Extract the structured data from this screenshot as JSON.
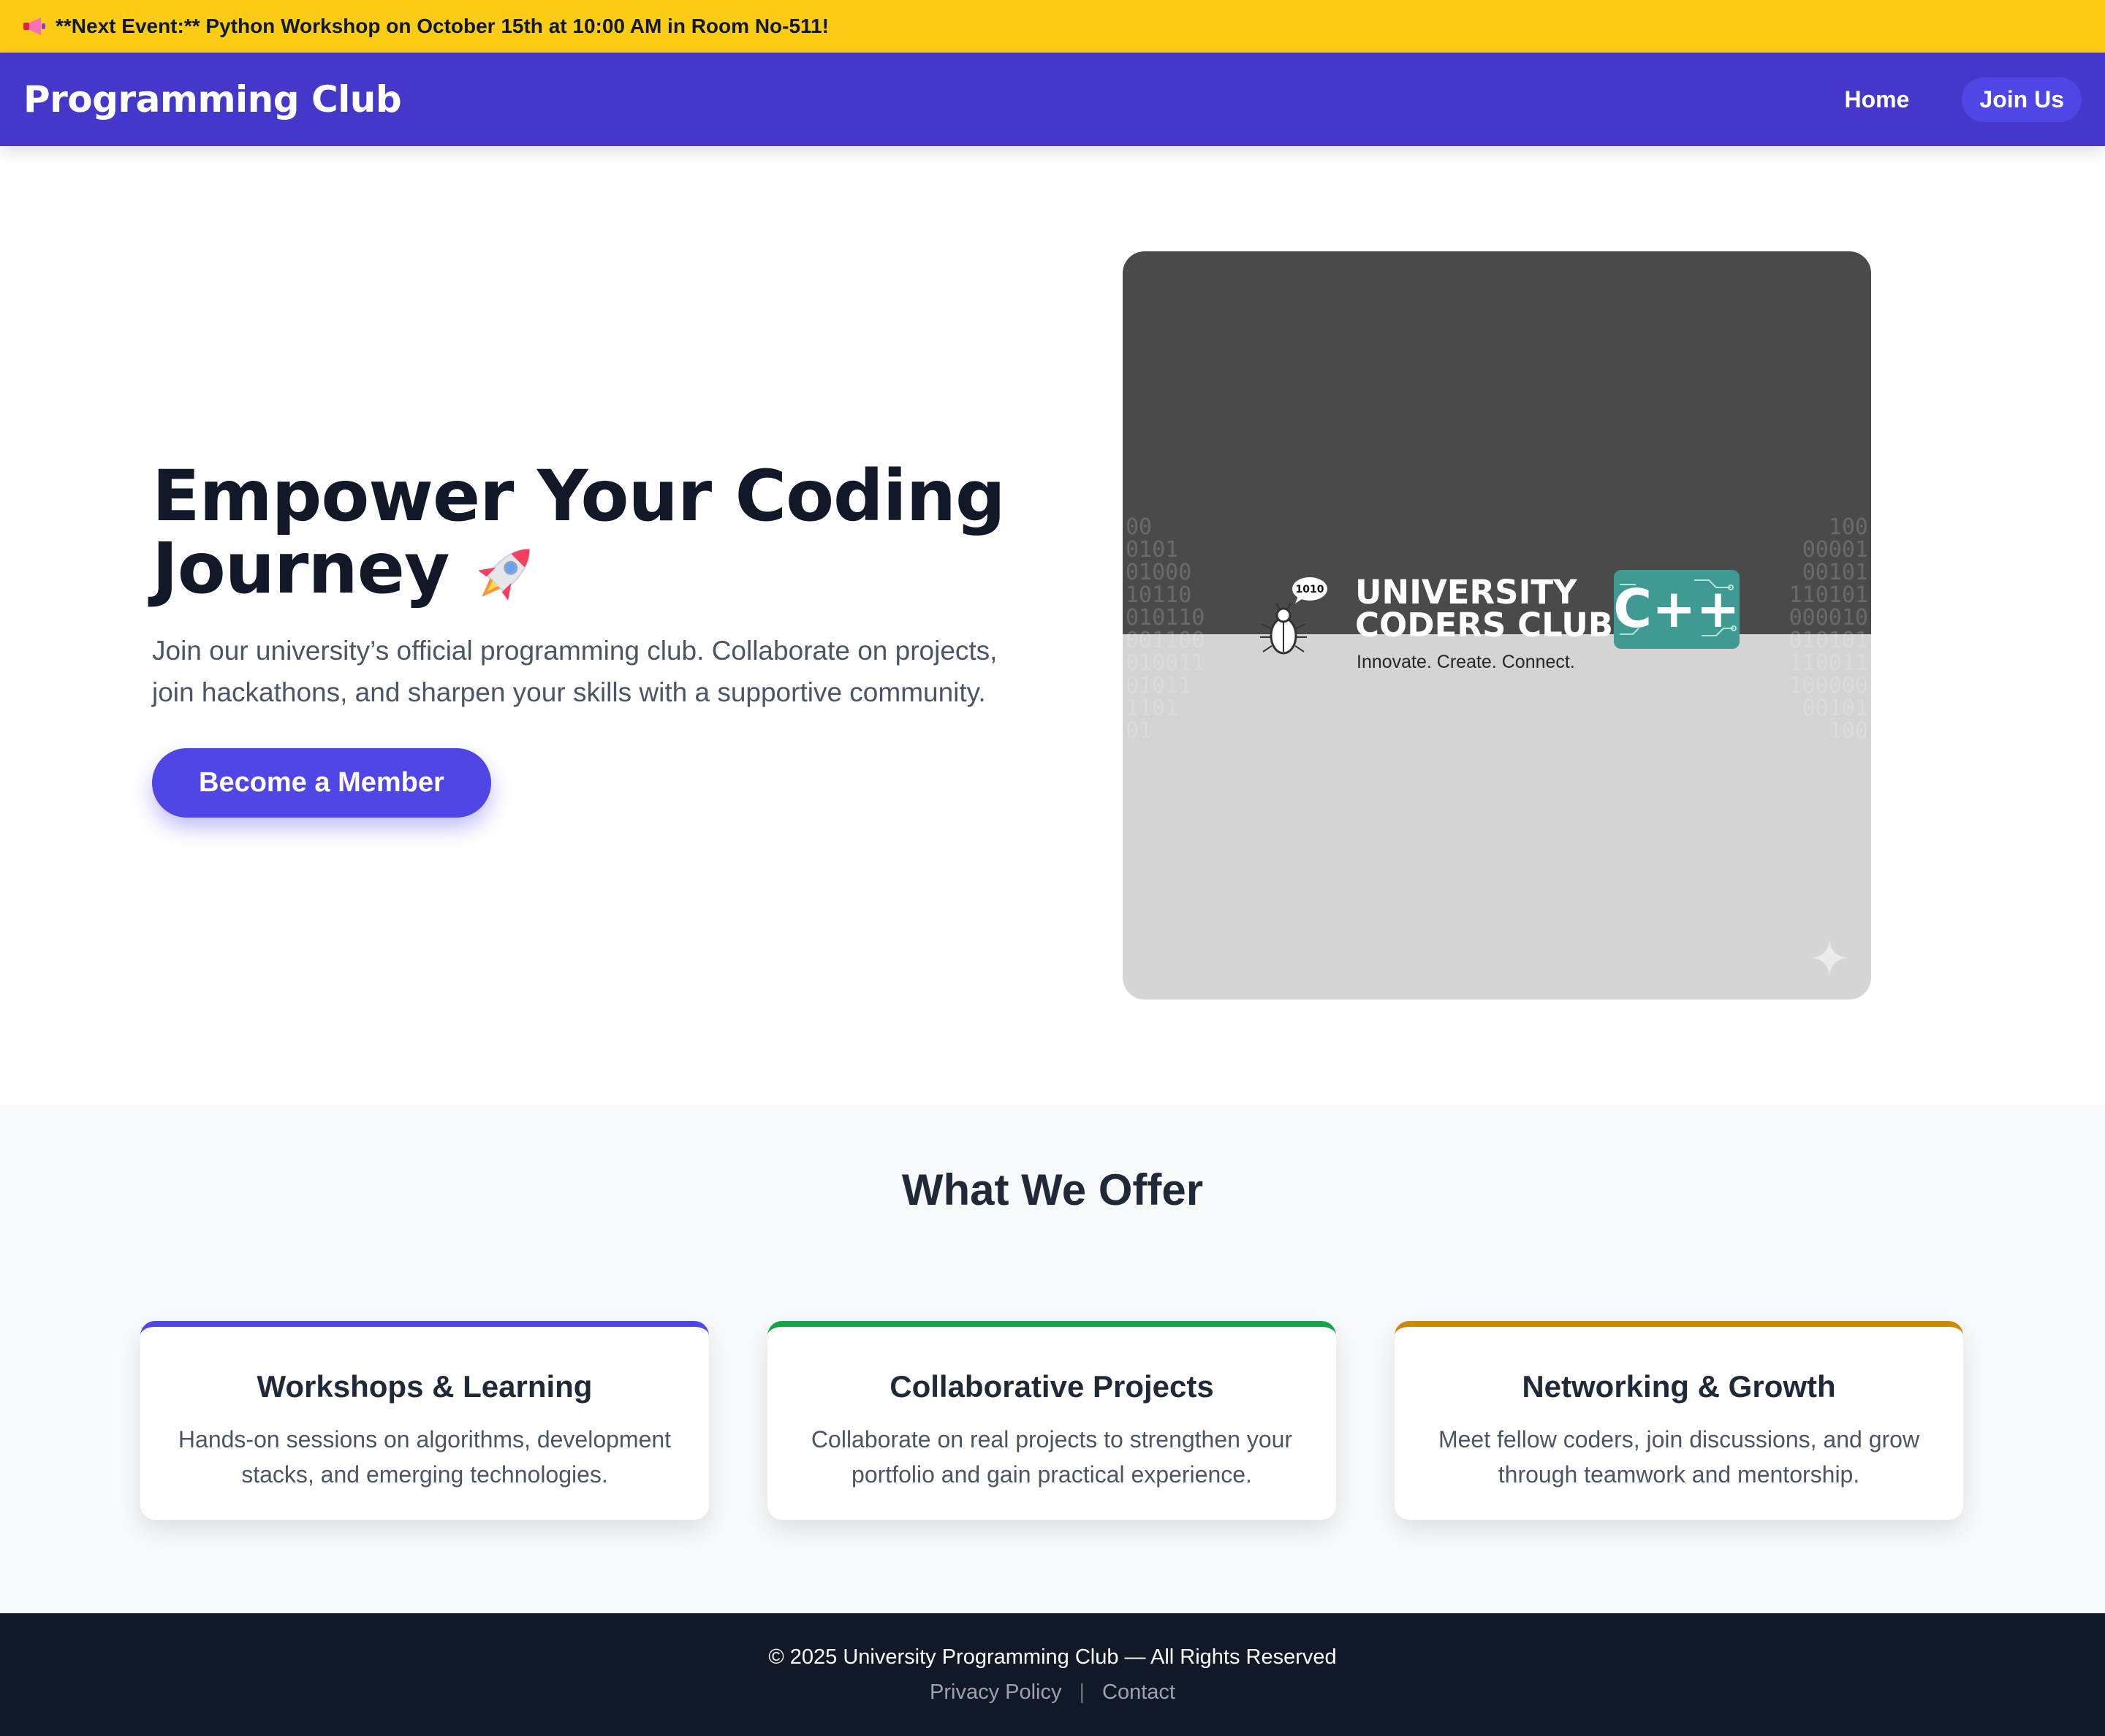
{
  "announcement": {
    "text": "**Next Event:** Python Workshop on October 15th at 10:00 AM in Room No-511!",
    "icon": "megaphone-icon"
  },
  "nav": {
    "brand": "Programming Club",
    "home": "Home",
    "join": "Join Us"
  },
  "hero": {
    "title_line1": "Empower Your Coding",
    "title_line2": "Journey",
    "title_icon": "rocket-icon",
    "subtitle": "Join our university’s official programming club. Collaborate on projects, join hackathons, and sharpen your skills with a supportive community.",
    "cta": "Become a Member",
    "image": {
      "badge": "1010",
      "name_line1": "UNIVERSITY",
      "name_line2": "CODERS CLUB",
      "tagline": "Innovate. Create. Connect.",
      "cpp_label": "C++"
    }
  },
  "offer": {
    "title": "What We Offer",
    "cards": [
      {
        "title": "Workshops & Learning",
        "text": "Hands-on sessions on algorithms, development stacks, and emerging technologies.",
        "accent": "#4f46e5"
      },
      {
        "title": "Collaborative Projects",
        "text": "Collaborate on real projects to strengthen your portfolio and gain practical experience.",
        "accent": "#16a34a"
      },
      {
        "title": "Networking & Growth",
        "text": "Meet fellow coders, join discussions, and grow through teamwork and mentorship.",
        "accent": "#ca8a04"
      }
    ]
  },
  "footer": {
    "copyright": "© 2025 University Programming Club — All Rights Reserved",
    "privacy": "Privacy Policy",
    "contact": "Contact"
  },
  "colors": {
    "banner": "#facc15",
    "nav": "#4338ca",
    "primary": "#4f46e5",
    "footer": "#111827"
  }
}
